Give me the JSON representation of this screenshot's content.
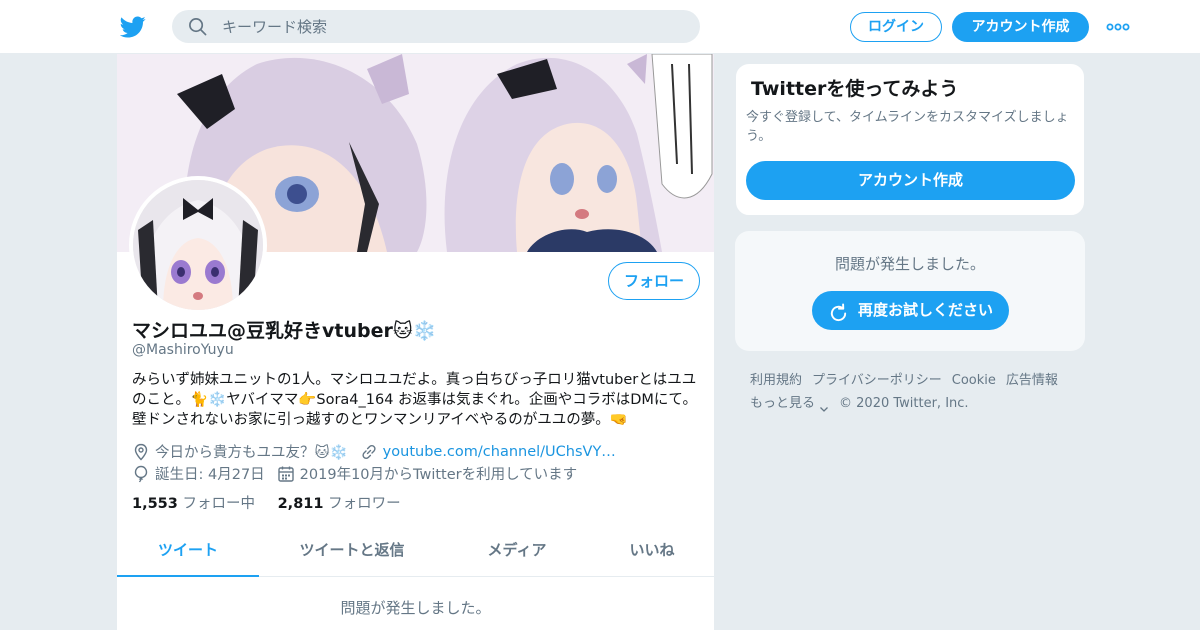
{
  "nav": {
    "search_placeholder": "キーワード検索",
    "login_label": "ログイン",
    "signup_label": "アカウント作成"
  },
  "profile": {
    "display_name": "マシロユユ@豆乳好きvtuber🐱❄️",
    "handle": "@MashiroYuyu",
    "bio": "みらいず姉妹ユニットの1人。マシロユユだよ。真っ白ちびっ子ロリ猫vtuberとはユユのこと。🐈❄️ヤバイママ👉Sora4_164 お返事は気まぐれ。企画やコラボはDMにて。壁ドンされないお家に引っ越すのとワンマンリアイベやるのがユユの夢。🤜",
    "location": "今日から貴方もユユ友？🐱❄️",
    "url": "youtube.com/channel/UChsVY…",
    "birthday": "誕生日: 4月27日",
    "joined": "2019年10月からTwitterを利用しています",
    "following_count": "1,553",
    "following_label": "フォロー中",
    "followers_count": "2,811",
    "followers_label": "フォロワー",
    "follow_button": "フォロー"
  },
  "tabs": [
    {
      "label": "ツイート"
    },
    {
      "label": "ツイートと返信"
    },
    {
      "label": "メディア"
    },
    {
      "label": "いいね"
    }
  ],
  "main_error": "問題が発生しました。",
  "sidebar": {
    "signup_card": {
      "title": "Twitterを使ってみよう",
      "text": "今すぐ登録して、タイムラインをカスタマイズしましょう。",
      "button": "アカウント作成"
    },
    "error_card": {
      "message": "問題が発生しました。",
      "retry_button": "再度お試しください"
    },
    "footer": {
      "links": [
        "利用規約",
        "プライバシーポリシー",
        "Cookie",
        "広告情報"
      ],
      "more": "もっと見る",
      "copyright": "© 2020 Twitter, Inc."
    }
  },
  "colors": {
    "accent": "#1da1f2",
    "secondary_text": "#657786",
    "link": "#1b95e0"
  },
  "icons": {
    "logo": "twitter-bird-icon",
    "search": "search-icon",
    "more": "more-dots-icon",
    "location": "location-pin-icon",
    "url": "link-icon",
    "birthday": "balloon-icon",
    "joined": "calendar-icon",
    "retry": "refresh-icon",
    "more_chevron": "chevron-down-icon"
  }
}
